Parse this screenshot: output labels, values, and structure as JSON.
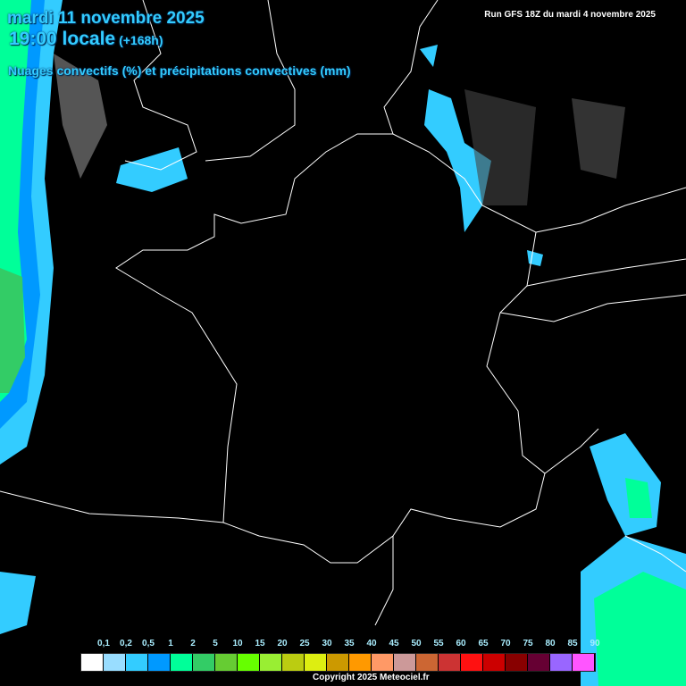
{
  "header": {
    "date": "mardi 11 novembre 2025",
    "time": "19:00 locale",
    "lead": "(+168h)",
    "parameter": "Nuages convectifs (%) et précipitations convectives (mm)",
    "run": "Run GFS 18Z du mardi 4 novembre 2025"
  },
  "legend": {
    "labels": [
      "0,1",
      "0,2",
      "0,5",
      "1",
      "2",
      "5",
      "10",
      "15",
      "20",
      "25",
      "30",
      "35",
      "40",
      "45",
      "50",
      "55",
      "60",
      "65",
      "70",
      "75",
      "80",
      "85",
      "90"
    ],
    "colors": [
      "#ffffff",
      "#99ddff",
      "#33ccff",
      "#0099ff",
      "#00ff99",
      "#33cc66",
      "#66cc33",
      "#66ff00",
      "#99ee33",
      "#bbcc11",
      "#ddee11",
      "#cc9900",
      "#ff9900",
      "#ff9966",
      "#cc9999",
      "#cc6633",
      "#cc3333",
      "#ff1111",
      "#cc0000",
      "#880000",
      "#660033",
      "#9966ff",
      "#ff55ff"
    ]
  },
  "footer": {
    "copyright": "Copyright 2025 Meteociel.fr"
  }
}
